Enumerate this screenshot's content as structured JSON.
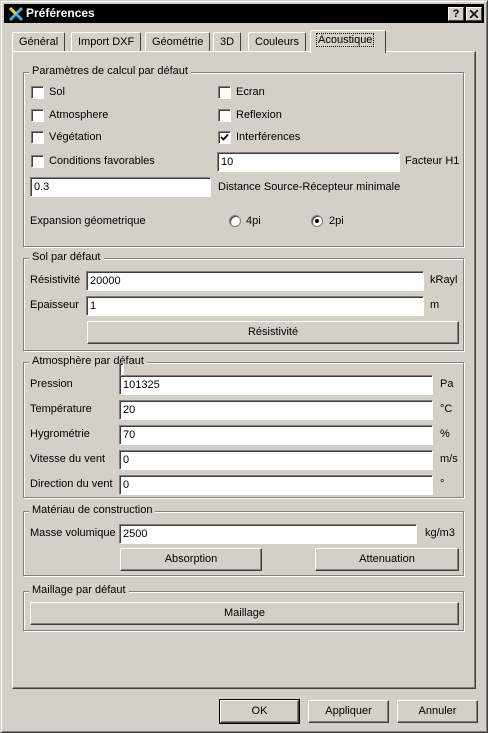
{
  "window": {
    "title": "Préférences",
    "help_glyph": "?",
    "close_glyph": "X",
    "icon": "app-icon"
  },
  "tabs": [
    {
      "label": "Général"
    },
    {
      "label": "Import DXF"
    },
    {
      "label": "Géométrie"
    },
    {
      "label": "3D"
    },
    {
      "label": "Couleurs"
    },
    {
      "label": "Acoustique",
      "active": true
    }
  ],
  "calc": {
    "title": "Paramètres de calcul par défaut",
    "sol": {
      "label": "Sol",
      "checked": false
    },
    "ecran": {
      "label": "Ecran",
      "checked": false
    },
    "atmosphere": {
      "label": "Atmosphere",
      "checked": false
    },
    "reflexion": {
      "label": "Reflexion",
      "checked": false
    },
    "vegetation": {
      "label": "Végétation",
      "checked": false
    },
    "interferences": {
      "label": "Interférences",
      "checked": true
    },
    "conditions": {
      "label": "Conditions favorables",
      "checked": false
    },
    "facteur_h1": {
      "value": "10",
      "label": "Facteur H1"
    },
    "distance": {
      "value": "0.3",
      "label": "Distance Source-Récepteur minimale"
    },
    "expansion": {
      "label": "Expansion géometrique",
      "options": [
        "4pi",
        "2pi"
      ],
      "selected": "2pi"
    }
  },
  "sol_defaut": {
    "title": "Sol par défaut",
    "resistivite": {
      "label": "Résistivité",
      "value": "20000",
      "unit": "kRayl"
    },
    "epaisseur": {
      "label": "Epaisseur",
      "value": "1",
      "unit": "m"
    },
    "button": "Résistivité"
  },
  "atmosphere_defaut": {
    "title": "Atmosphère par défaut",
    "pression": {
      "label": "Pression",
      "value": "101325",
      "unit": "Pa"
    },
    "temperature": {
      "label": "Température",
      "value": "20",
      "unit": "°C"
    },
    "hygrometrie": {
      "label": "Hygrométrie",
      "value": "70",
      "unit": "%"
    },
    "vitesse": {
      "label": "Vitesse du vent",
      "value": "0",
      "unit": "m/s"
    },
    "direction": {
      "label": "Direction du vent",
      "value": "0",
      "unit": "°"
    }
  },
  "materiau": {
    "title": "Matériau de construction",
    "masse": {
      "label": "Masse volumique",
      "value": "2500",
      "unit": "kg/m3"
    },
    "absorption": "Absorption",
    "attenuation": "Attenuation"
  },
  "maillage": {
    "title": "Maillage par défaut",
    "button": "Maillage"
  },
  "footer": {
    "ok": "OK",
    "appliquer": "Appliquer",
    "annuler": "Annuler"
  }
}
